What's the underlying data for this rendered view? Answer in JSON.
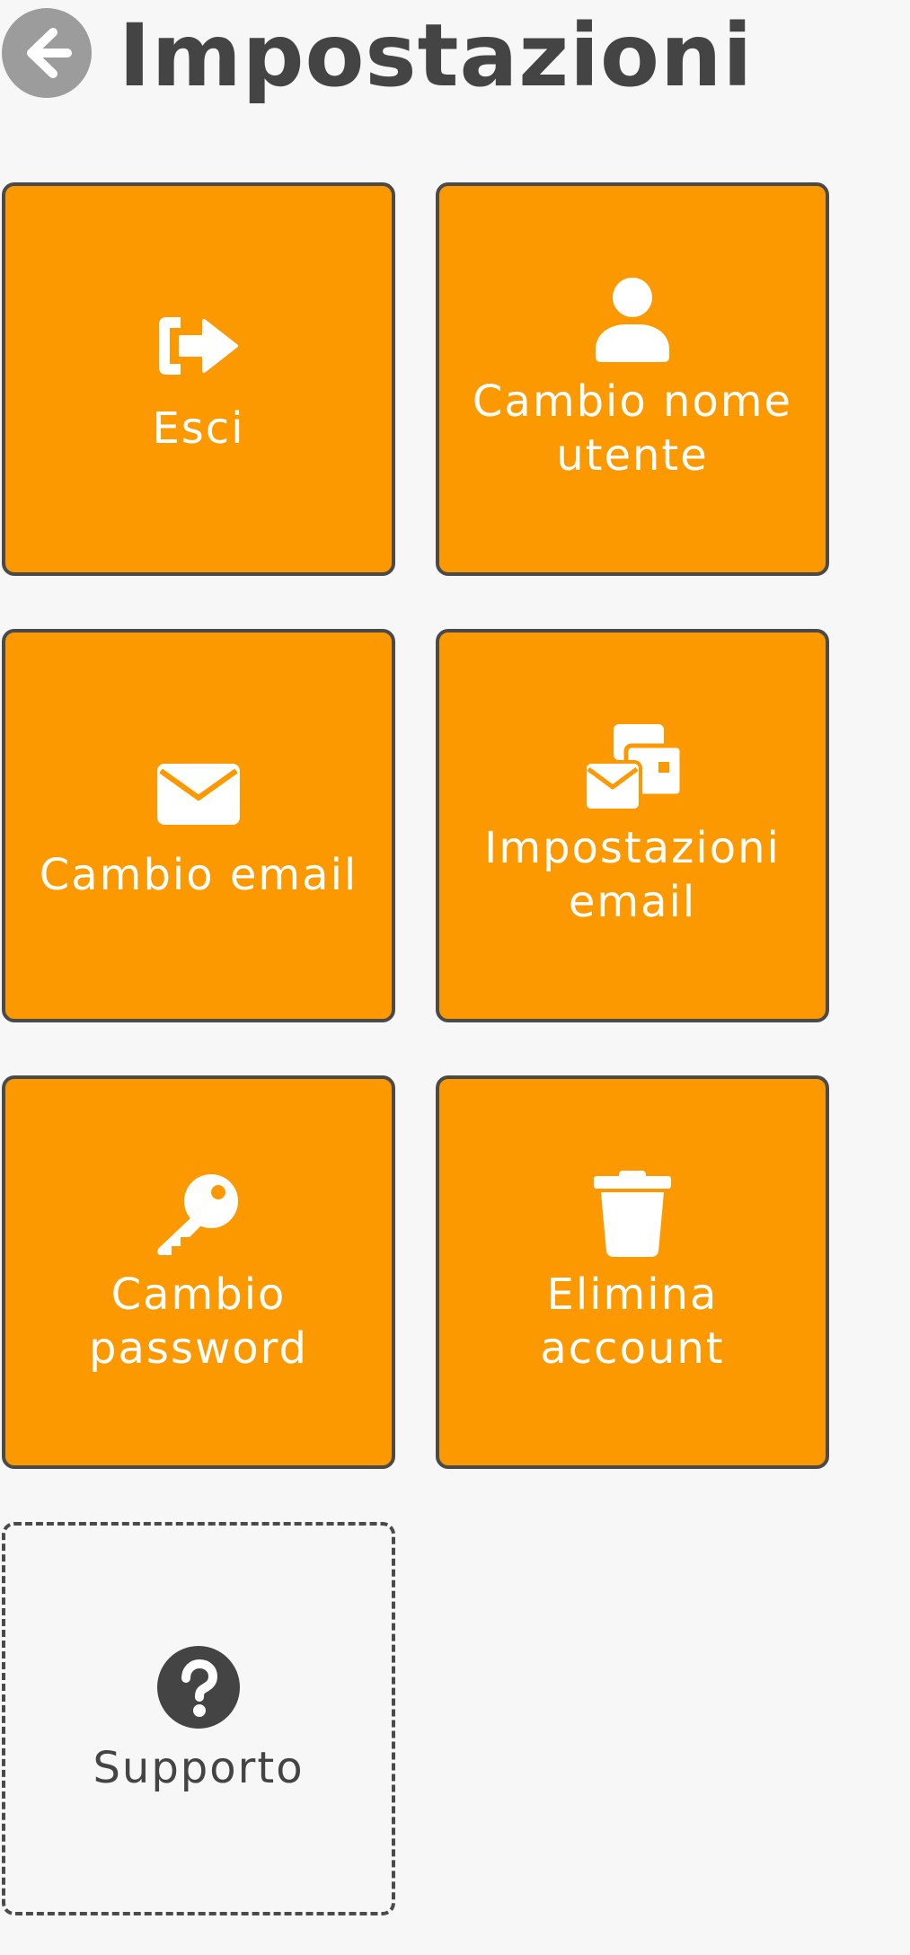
{
  "header": {
    "back_icon": "arrow-left-icon",
    "title": "Impostazioni"
  },
  "colors": {
    "tile_background": "#fd9900",
    "tile_border": "#4a4a4a",
    "tile_text": "#ffffff",
    "page_background": "#f7f7f7",
    "title_text": "#444444",
    "back_button": "#9c9c9c"
  },
  "tiles": [
    {
      "label": "Esci",
      "icon": "logout-icon"
    },
    {
      "label": "Cambio nome utente",
      "icon": "user-icon"
    },
    {
      "label": "Cambio email",
      "icon": "envelope-icon"
    },
    {
      "label": "Impostazioni email",
      "icon": "email-settings-icon"
    },
    {
      "label": "Cambio password",
      "icon": "key-icon"
    },
    {
      "label": "Elimina account",
      "icon": "trash-icon"
    },
    {
      "label": "Supporto",
      "icon": "question-circle-icon"
    }
  ]
}
